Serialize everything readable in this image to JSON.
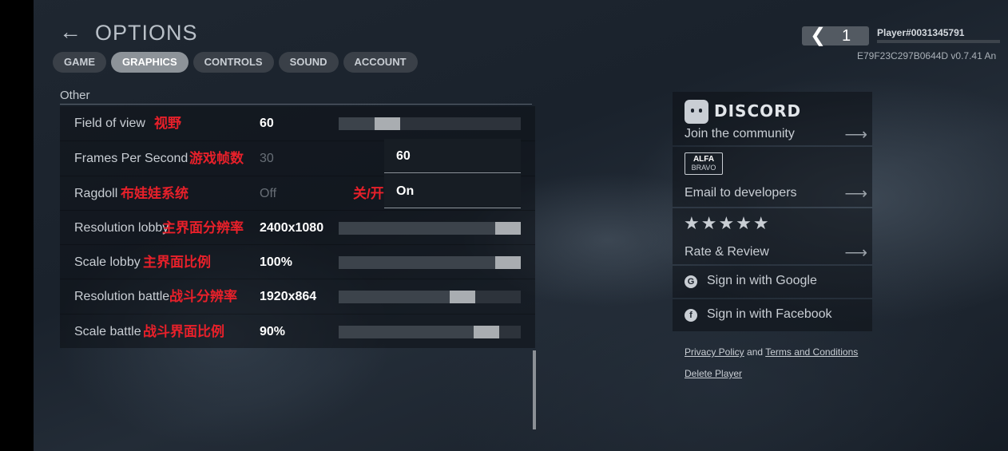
{
  "header": {
    "back_glyph": "←",
    "title": "OPTIONS",
    "tabs": [
      "GAME",
      "GRAPHICS",
      "CONTROLS",
      "SOUND",
      "ACCOUNT"
    ],
    "active_tab": "GRAPHICS"
  },
  "settings": {
    "section_label": "Other",
    "rows": [
      {
        "label": "Field of view",
        "note": "视野",
        "value": "60",
        "slider_level": 0.23
      },
      {
        "label": "Frames Per Second",
        "note": "游戏帧数",
        "off_value": "30",
        "on_value": "60"
      },
      {
        "label": "Ragdoll",
        "note": "布娃娃系统",
        "off_value": "Off",
        "toggle_note": "关/开",
        "on_value": "On"
      },
      {
        "label": "Resolution lobby",
        "note": "主界面分辨率",
        "value": "2400x1080",
        "slider_level": 1.0
      },
      {
        "label": "Scale lobby",
        "note": "主界面比例",
        "value": "100%",
        "slider_level": 1.0
      },
      {
        "label": "Resolution battle",
        "note": "战斗分辨率",
        "value": "1920x864",
        "slider_level": 0.71
      },
      {
        "label": "Scale battle",
        "note": "战斗界面比例",
        "value": "90%",
        "slider_level": 0.86
      }
    ]
  },
  "player": {
    "level": "1",
    "name": "Player#0031345791",
    "version": "E79F23C297B0644D v0.7.41 An"
  },
  "community": {
    "discord_word": "DISCORD",
    "discord_label": "Join the community",
    "alfa_top": "ALFA",
    "alfa_bottom": "BRAVO",
    "email_label": "Email to developers",
    "stars": "★★★★★",
    "rate_label": "Rate & Review",
    "arrow": "⟶",
    "google_label": "Sign in with Google",
    "facebook_label": "Sign in with Facebook",
    "google_glyph": "G",
    "facebook_glyph": "f"
  },
  "footer": {
    "privacy": "Privacy Policy",
    "and": "and",
    "terms": "Terms and Conditions",
    "delete": "Delete Player"
  },
  "colors": {
    "annotation_red": "#e8202a",
    "tab_active": "#8d9399",
    "tab_inactive": "#3a4048"
  }
}
